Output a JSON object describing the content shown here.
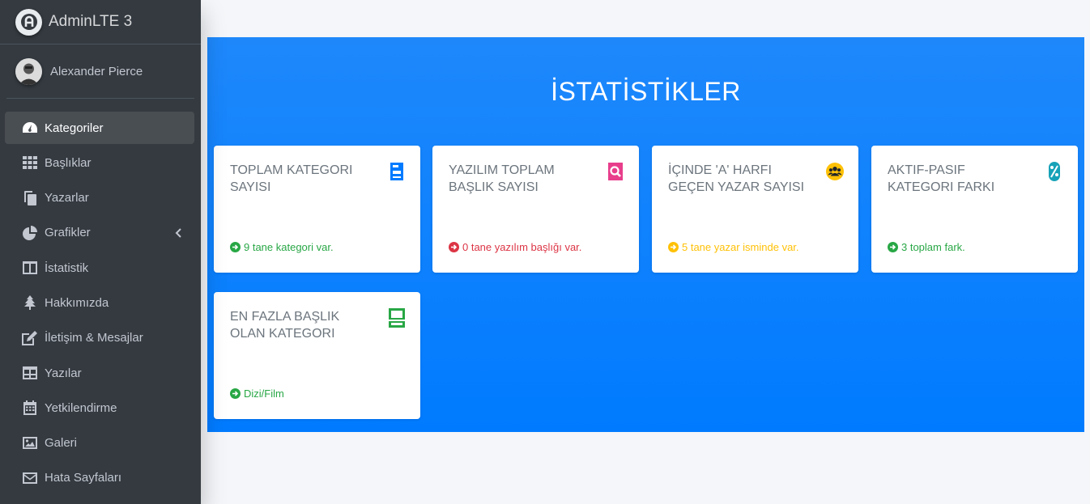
{
  "brand": {
    "name": "AdminLTE 3"
  },
  "user": {
    "name": "Alexander Pierce"
  },
  "sidebar": {
    "items": [
      {
        "label": "Kategoriler",
        "icon": "tachometer-icon",
        "active": true
      },
      {
        "label": "Başlıklar",
        "icon": "grid-icon"
      },
      {
        "label": "Yazarlar",
        "icon": "copy-icon"
      },
      {
        "label": "Grafikler",
        "icon": "pie-chart-icon",
        "has_arrow": true
      },
      {
        "label": "İstatistik",
        "icon": "columns-icon"
      },
      {
        "label": "Hakkımızda",
        "icon": "tree-icon"
      },
      {
        "label": "İletişim & Mesajlar",
        "icon": "edit-icon"
      },
      {
        "label": "Yazılar",
        "icon": "table-icon"
      },
      {
        "label": "Yetkilendirme",
        "icon": "calendar-icon"
      },
      {
        "label": "Galeri",
        "icon": "image-icon"
      },
      {
        "label": "Hata Sayfaları",
        "icon": "envelope-icon"
      }
    ]
  },
  "main": {
    "title": "İSTATİSTİKLER",
    "cards": [
      {
        "title": "TOPLAM KATEGORI SAYISI",
        "footer": "9 tane kategori var.",
        "icon": "server-icon",
        "icon_color": "#007bff",
        "footer_color": "#28a745",
        "footer_icon": "arrow-right-circle-icon"
      },
      {
        "title": "YAZILIM TOPLAM BAŞLIK SAYISI",
        "footer": "0 tane yazılım başlığı var.",
        "icon": "search-icon",
        "icon_color": "#e83e8c",
        "footer_color": "#dc3545",
        "footer_icon": "arrow-right-circle-icon"
      },
      {
        "title": "İÇINDE 'A' HARFI GEÇEN YAZAR SAYISI",
        "footer": "5 tane yazar isminde var.",
        "icon": "users-icon",
        "icon_color": "#ffc107",
        "footer_color": "#ffc107",
        "footer_icon": "arrow-right-circle-icon"
      },
      {
        "title": "AKTIF-PASIF KATEGORI FARKI",
        "footer": "3 toplam fark.",
        "icon": "percent-icon",
        "icon_color": "#17a2b8",
        "footer_color": "#28a745",
        "footer_icon": "arrow-right-circle-icon"
      },
      {
        "title": "EN FAZLA BAŞLIK OLAN KATEGORI",
        "footer": "Dizi/Film",
        "icon": "hdd-icon",
        "icon_color": "#28a745",
        "footer_color": "#28a745",
        "footer_icon": "arrow-right-circle-icon"
      }
    ]
  }
}
